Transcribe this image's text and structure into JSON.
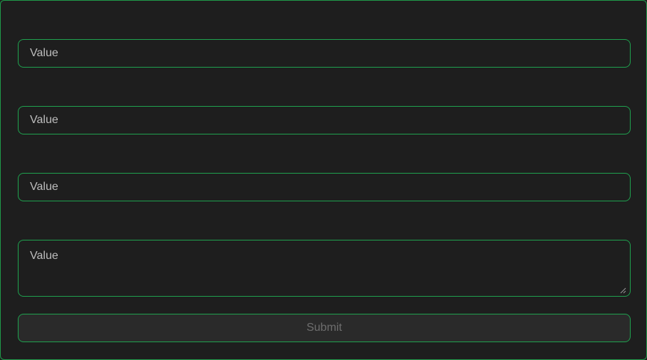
{
  "form": {
    "fields": [
      {
        "value": "Value"
      },
      {
        "value": "Value"
      },
      {
        "value": "Value"
      }
    ],
    "textarea": {
      "value": "Value"
    },
    "submit_label": "Submit"
  },
  "colors": {
    "background": "#1e1e1e",
    "accent_border": "#1fa24f",
    "text": "#bdbdbd",
    "button_background": "#2a2a2a",
    "button_text": "#6e6e6e"
  },
  "icons": {
    "resize_handle": "resize-handle-icon"
  }
}
